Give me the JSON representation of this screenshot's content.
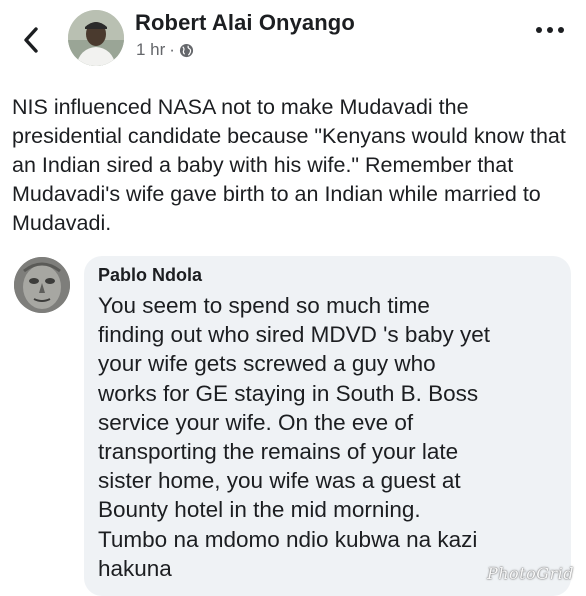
{
  "post": {
    "author_name": "Robert Alai Onyango",
    "timestamp": "1 hr",
    "separator": "·",
    "audience_icon": "globe-icon",
    "body": "NIS influenced NASA not to make Mudavadi the presidential candidate because \"Kenyans would know that an Indian sired a baby with his wife.\" Remember that Mudavadi's wife gave birth to an Indian while married to Mudavadi."
  },
  "header": {
    "back_icon": "chevron-left-icon",
    "more_icon": "more-options-icon"
  },
  "comment": {
    "author_name": "Pablo Ndola",
    "body": "You seem to spend so much time\nfinding out who sired MDVD 's baby yet\nyour wife gets screwed a guy who\nworks for GE staying in South B. Boss\nservice your wife. On the eve of\ntransporting the remains of your late\nsister home, you wife was a guest at\nBounty hotel in the mid morning.\nTumbo na mdomo ndio kubwa na kazi\nhakuna"
  },
  "watermark": "PhotoGrid",
  "colors": {
    "text_primary": "#1c1e21",
    "text_secondary": "#65676b",
    "comment_bubble": "#eff2f5"
  }
}
